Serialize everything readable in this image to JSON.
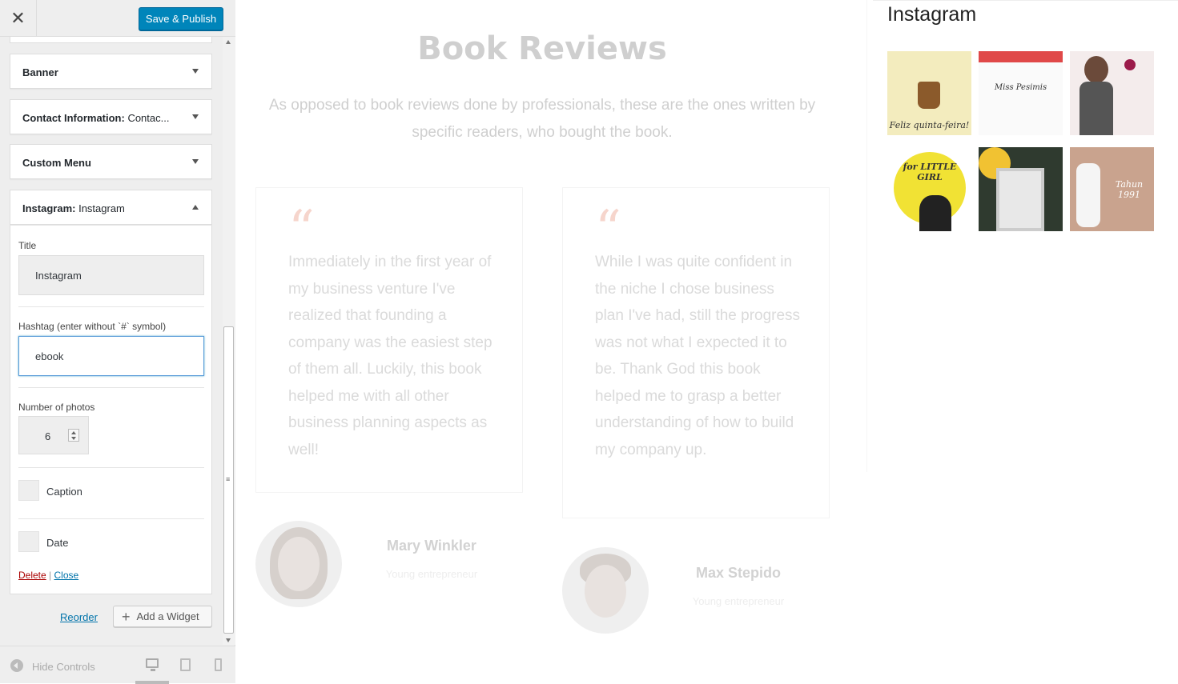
{
  "topbar": {
    "close_icon": "close-icon",
    "save_label": "Save & Publish"
  },
  "widgets": [
    {
      "title": "Banner",
      "subtitle": ""
    },
    {
      "title": "Contact Information:",
      "subtitle": " Contac..."
    },
    {
      "title": "Custom Menu",
      "subtitle": ""
    },
    {
      "title": "Instagram:",
      "subtitle": " Instagram"
    }
  ],
  "instagram_form": {
    "title_label": "Title",
    "title_value": "Instagram",
    "hashtag_label": "Hashtag (enter without `#` symbol)",
    "hashtag_value": "ebook",
    "number_label": "Number of photos",
    "number_value": "6",
    "caption_label": "Caption",
    "date_label": "Date",
    "delete_label": "Delete",
    "separator": " | ",
    "close_label": "Close"
  },
  "actions": {
    "reorder_label": "Reorder",
    "add_widget_label": "Add a Widget"
  },
  "footer": {
    "hide_label": "Hide Controls",
    "devices": [
      "desktop-icon",
      "tablet-icon",
      "mobile-icon"
    ]
  },
  "preview": {
    "title": "Book Reviews",
    "subtitle": "As opposed to book reviews done by professionals, these are the ones written by specific readers, who bought the book.",
    "quote_mark": "“",
    "reviews": [
      {
        "text": "Immediately in the first year of my business venture I've realized that founding a company was the easiest step of them all. Luckily, this book helped me with all other business planning as­pects as well!",
        "name": "Mary Winkler",
        "role": "Young entrepreneur"
      },
      {
        "text": "While I was quite confident in the niche I chose business plan I've had, still the progress was not what I ex­pected it to be. Thank God this book helped me to grasp a better understand­ing of how to build my com­pany up.",
        "name": "Max Stepido",
        "role": "Young entrepreneur"
      }
    ],
    "instagram": {
      "title": "Instagram",
      "captions": [
        "Feliz quinta-feira!",
        "Miss Pesimis",
        "",
        "for LITTLE GIRL",
        "",
        "Tahun 1991"
      ]
    }
  }
}
